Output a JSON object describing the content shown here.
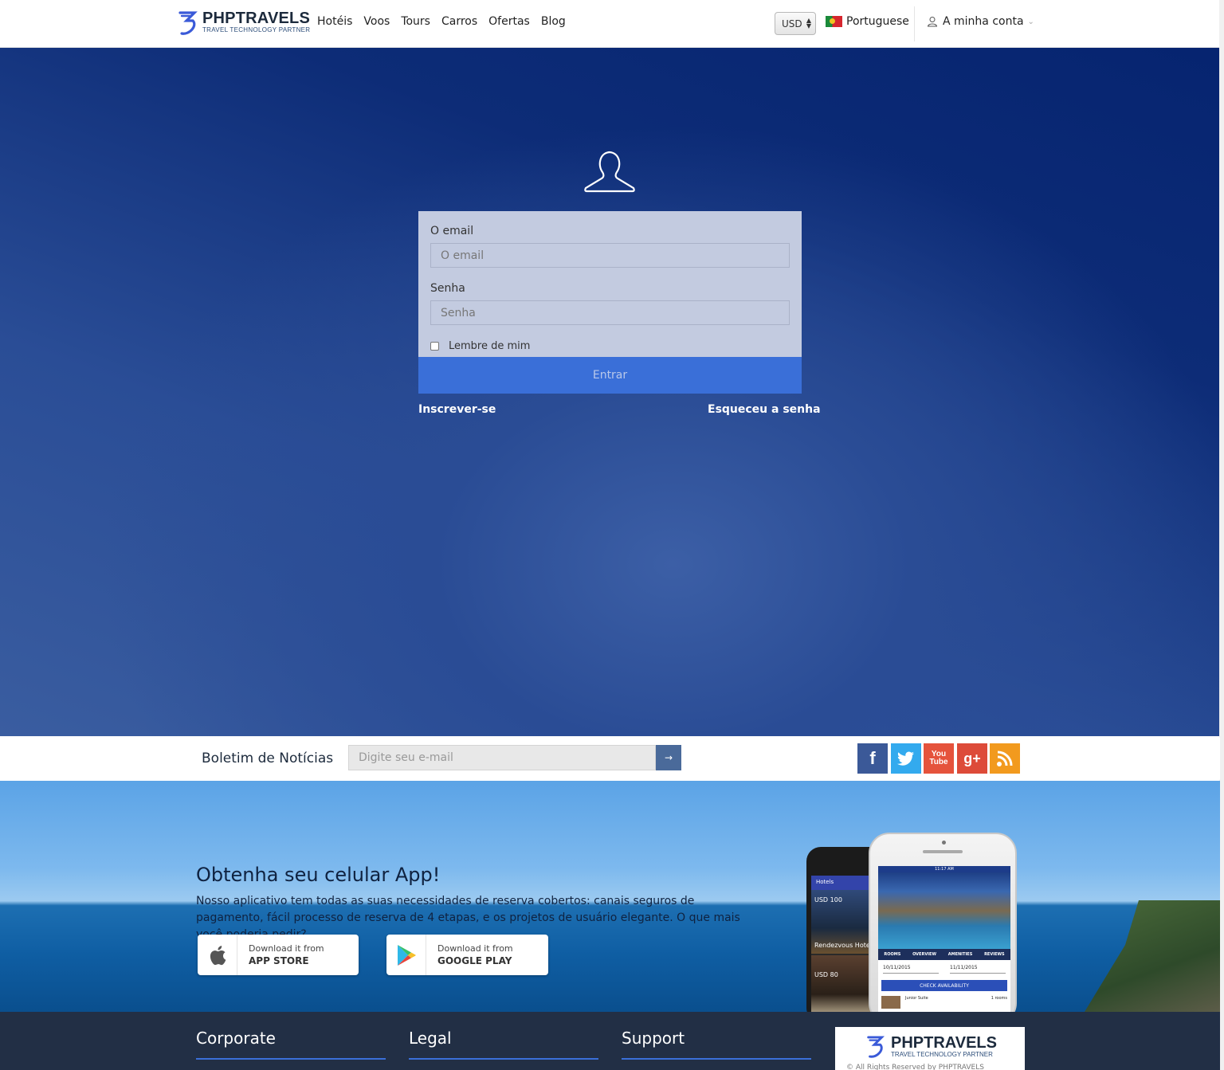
{
  "header": {
    "logo_name": "PHPTRAVELS",
    "logo_tagline": "TRAVEL TECHNOLOGY PARTNER",
    "nav": [
      "Hotéis",
      "Voos",
      "Tours",
      "Carros",
      "Ofertas",
      "Blog"
    ],
    "currency": "USD",
    "language": "Portuguese",
    "account": "A minha conta"
  },
  "login": {
    "email_label": "O email",
    "email_placeholder": "O email",
    "password_label": "Senha",
    "password_placeholder": "Senha",
    "remember": "Lembre de mim",
    "submit": "Entrar",
    "signup": "Inscrever-se",
    "forgot": "Esqueceu a senha"
  },
  "newsletter": {
    "title": "Boletim de Notícias",
    "placeholder": "Digite seu e-mail",
    "social": [
      "facebook-icon",
      "twitter-icon",
      "youtube-icon",
      "google-plus-icon",
      "rss-icon"
    ]
  },
  "app": {
    "title": "Obtenha seu celular App!",
    "description": "Nosso aplicativo tem todas as suas necessidades de reserva cobertos: canais seguros de pagamento, fácil processo de reserva de 4 etapas, e os projetos de usuário elegante. O que mais você poderia pedir?",
    "appstore_small": "Download it from",
    "appstore_big": "APP STORE",
    "gplay_small": "Download it from",
    "gplay_big": "GOOGLE PLAY",
    "phone_back": {
      "bar": "Hotels",
      "price1": "USD 100",
      "price2": "USD 80",
      "hotel": "Rendezvous Hotels"
    },
    "phone_front": {
      "time": "11:17 AM",
      "tabs": [
        "ROOMS",
        "OVERVIEW",
        "AMENITIES",
        "REVIEWS"
      ],
      "date_in": "10/11/2015",
      "date_out": "11/11/2015",
      "check": "CHECK AVAILABILITY",
      "room": "Junior Suite",
      "rooms": "1 rooms"
    }
  },
  "footer": {
    "columns": [
      "Corporate",
      "Legal",
      "Support"
    ],
    "logo_name": "PHPTRAVELS",
    "logo_tagline": "TRAVEL TECHNOLOGY PARTNER",
    "copyright": "© All Rights Reserved by PHPTRAVELS"
  },
  "colors": {
    "accent": "#3a6fd8",
    "hero_dark": "#062470",
    "footer_bg": "#222f45"
  }
}
